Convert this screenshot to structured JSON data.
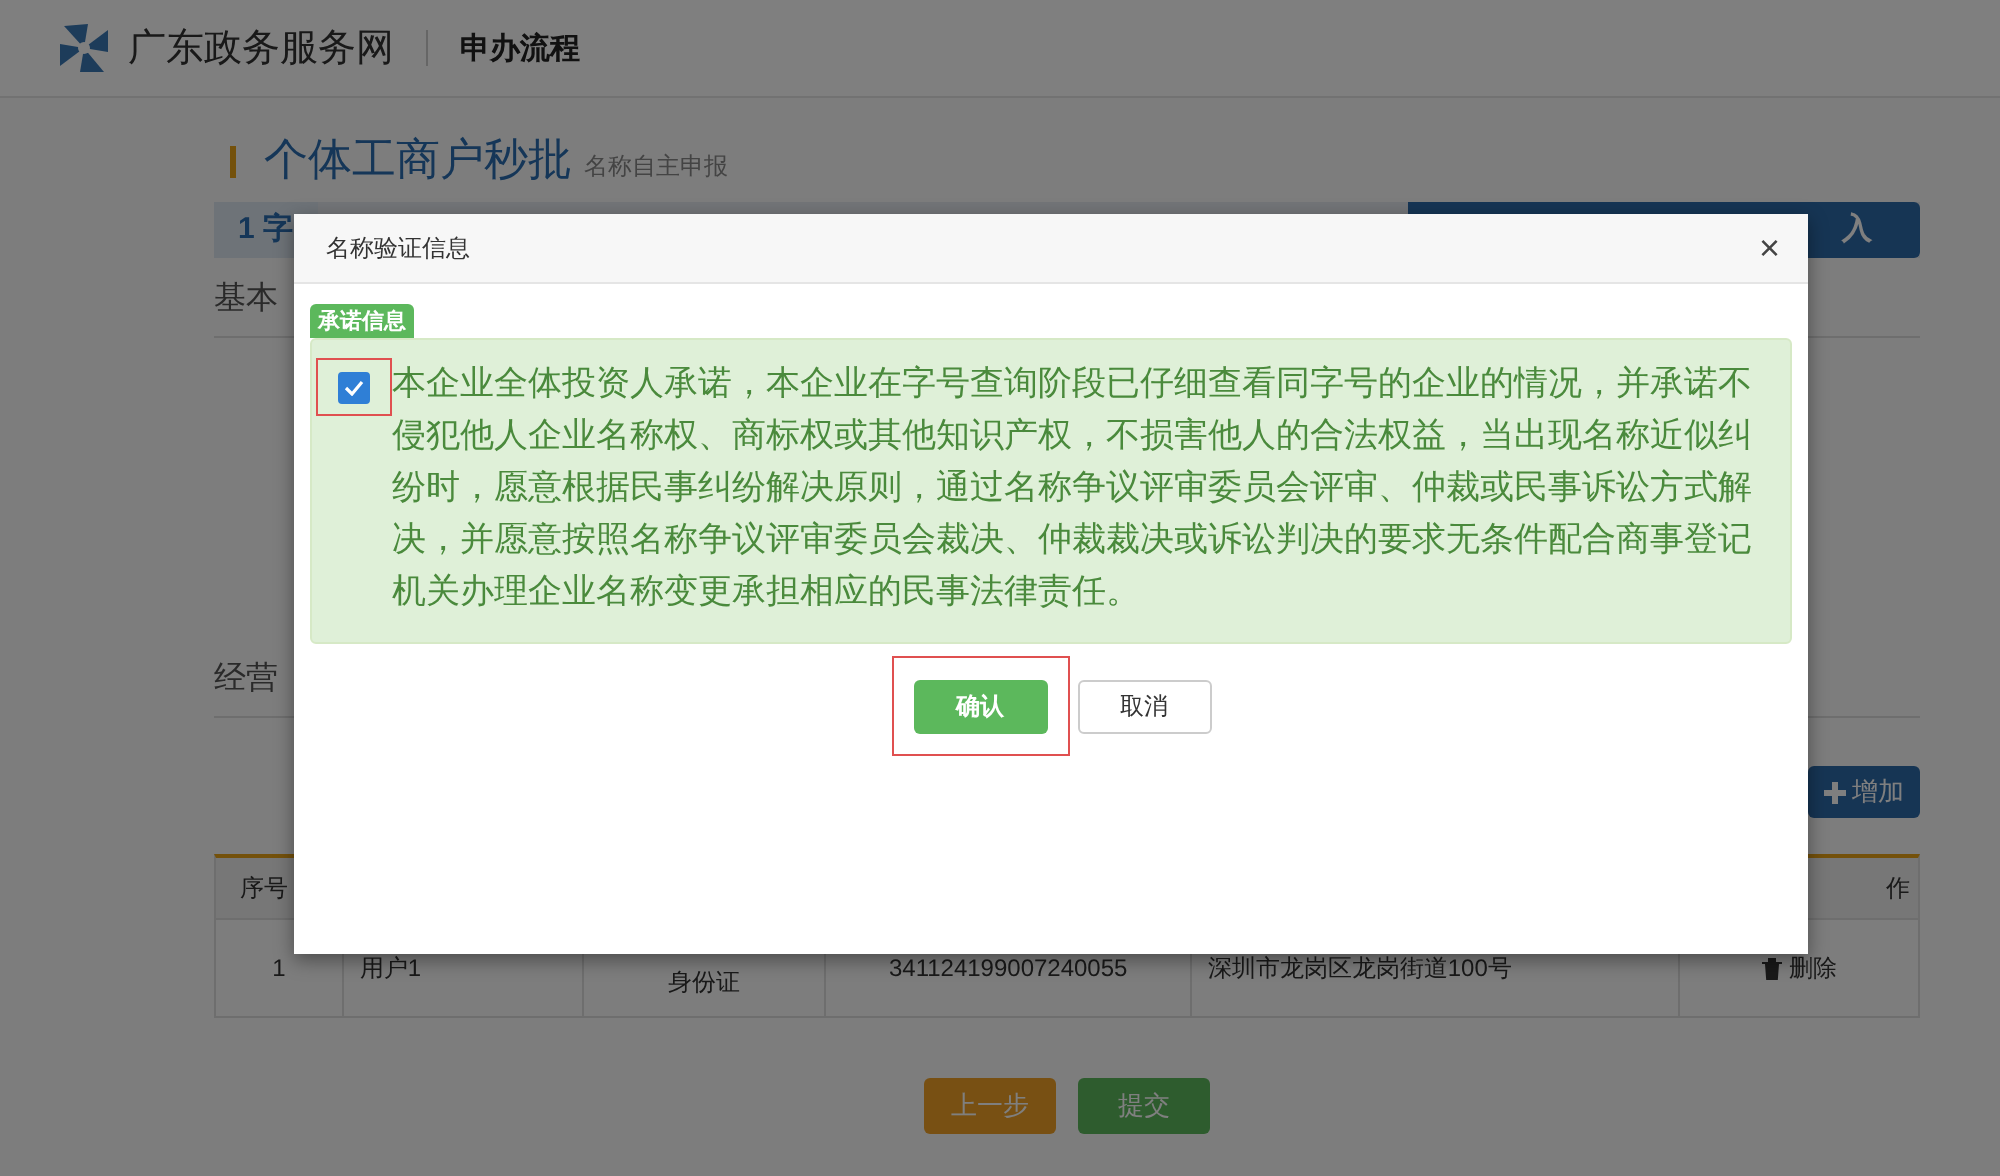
{
  "header": {
    "site_name": "广东政务服务网",
    "section": "申办流程"
  },
  "page": {
    "title": "个体工商户秒批",
    "subtitle": "名称自主申报",
    "steps": [
      {
        "label": "1 字",
        "kind": "current"
      },
      {
        "label": "入",
        "kind": "last"
      }
    ],
    "sections": [
      "基本",
      "经营"
    ],
    "add_button": "增加",
    "table": {
      "columns": [
        "序号",
        "作"
      ],
      "rows": [
        {
          "cells": [
            "1",
            "用户1",
            "身份证",
            "341124199007240055",
            "深圳市龙岗区龙岗街道100号"
          ],
          "action": "删除"
        }
      ]
    },
    "buttons": [
      {
        "label": "上一步",
        "kind": "back"
      },
      {
        "label": "提交",
        "kind": "submit"
      }
    ]
  },
  "modal": {
    "title": "名称验证信息",
    "close": "×",
    "tag": "承诺信息",
    "promise": {
      "checked": true,
      "text": "本企业全体投资人承诺，本企业在字号查询阶段已仔细查看同字号的企业的情况，并承诺不侵犯他人企业名称权、商标权或其他知识产权，不损害他人的合法权益，当出现名称近似纠纷时，愿意根据民事纠纷解决原则，通过名称争议评审委员会评审、仲裁或民事诉讼方式解决，并愿意按照名称争议评审委员会裁决、仲裁裁决或诉讼判决的要求无条件配合商事登记机关办理企业名称变更承担相应的民事法律责任。"
    },
    "buttons": [
      {
        "label": "确认",
        "kind": "primary"
      },
      {
        "label": "取消",
        "kind": "default"
      }
    ]
  }
}
